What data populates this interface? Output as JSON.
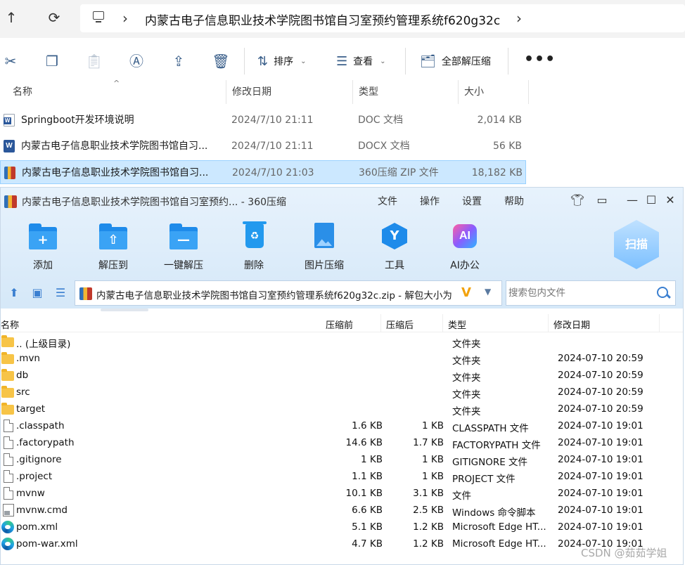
{
  "explorer": {
    "address_path": "内蒙古电子信息职业技术学院图书馆自习室预约管理系统f620g32c",
    "toolbar": {
      "sort_label": "排序",
      "view_label": "查看",
      "extract_all_label": "全部解压缩"
    },
    "columns": {
      "name": "名称",
      "date": "修改日期",
      "type": "类型",
      "size": "大小"
    },
    "files": [
      {
        "name": "Springboot开发环境说明",
        "date": "2024/7/10 21:11",
        "type": "DOC 文档",
        "size": "2,014 KB",
        "icon": "word-doc-icon"
      },
      {
        "name": "内蒙古电子信息职业技术学院图书馆自习...",
        "date": "2024/7/10 21:11",
        "type": "DOCX 文档",
        "size": "56 KB",
        "icon": "word-docx-icon"
      },
      {
        "name": "内蒙古电子信息职业技术学院图书馆自习...",
        "date": "2024/7/10 21:03",
        "type": "360压缩 ZIP 文件",
        "size": "18,182 KB",
        "icon": "zip-archive-icon",
        "selected": true
      }
    ]
  },
  "zipwin": {
    "title": "内蒙古电子信息职业技术学院图书馆自习室预约... - 360压缩",
    "menu": [
      "文件",
      "操作",
      "设置",
      "帮助"
    ],
    "tools": [
      "添加",
      "解压到",
      "一键解压",
      "删除",
      "图片压缩",
      "工具",
      "AI办公"
    ],
    "scan_label": "扫描",
    "path_text": "内蒙古电子信息职业技术学院图书馆自习室预约管理系统f620g32c.zip - 解包大小为",
    "search_placeholder": "搜索包内文件",
    "columns": {
      "name": "名称",
      "compressed_before": "压缩前",
      "compressed_after": "压缩后",
      "type": "类型",
      "date": "修改日期"
    },
    "files": [
      {
        "name": ".. (上级目录)",
        "orig": "",
        "comp": "",
        "type": "文件夹",
        "date": "",
        "icon": "folder-icon"
      },
      {
        "name": ".mvn",
        "orig": "",
        "comp": "",
        "type": "文件夹",
        "date": "2024-07-10 20:59",
        "icon": "folder-icon"
      },
      {
        "name": "db",
        "orig": "",
        "comp": "",
        "type": "文件夹",
        "date": "2024-07-10 20:59",
        "icon": "folder-icon"
      },
      {
        "name": "src",
        "orig": "",
        "comp": "",
        "type": "文件夹",
        "date": "2024-07-10 20:59",
        "icon": "folder-icon"
      },
      {
        "name": "target",
        "orig": "",
        "comp": "",
        "type": "文件夹",
        "date": "2024-07-10 20:59",
        "icon": "folder-icon"
      },
      {
        "name": ".classpath",
        "orig": "1.6 KB",
        "comp": "1 KB",
        "type": "CLASSPATH 文件",
        "date": "2024-07-10 19:01",
        "icon": "file-icon"
      },
      {
        "name": ".factorypath",
        "orig": "14.6 KB",
        "comp": "1.7 KB",
        "type": "FACTORYPATH 文件",
        "date": "2024-07-10 19:01",
        "icon": "file-icon"
      },
      {
        "name": ".gitignore",
        "orig": "1 KB",
        "comp": "1 KB",
        "type": "GITIGNORE 文件",
        "date": "2024-07-10 19:01",
        "icon": "file-icon"
      },
      {
        "name": ".project",
        "orig": "1.1 KB",
        "comp": "1 KB",
        "type": "PROJECT 文件",
        "date": "2024-07-10 19:01",
        "icon": "file-icon"
      },
      {
        "name": "mvnw",
        "orig": "10.1 KB",
        "comp": "3.1 KB",
        "type": "文件",
        "date": "2024-07-10 19:01",
        "icon": "file-icon"
      },
      {
        "name": "mvnw.cmd",
        "orig": "6.6 KB",
        "comp": "2.5 KB",
        "type": "Windows 命令脚本",
        "date": "2024-07-10 19:01",
        "icon": "cmd-script-icon"
      },
      {
        "name": "pom.xml",
        "orig": "5.1 KB",
        "comp": "1.2 KB",
        "type": "Microsoft Edge HT...",
        "date": "2024-07-10 19:01",
        "icon": "edge-icon"
      },
      {
        "name": "pom-war.xml",
        "orig": "4.7 KB",
        "comp": "1.2 KB",
        "type": "Microsoft Edge HT...",
        "date": "2024-07-10 19:01",
        "icon": "edge-icon"
      }
    ]
  },
  "watermark": "CSDN @茹茹学姐"
}
